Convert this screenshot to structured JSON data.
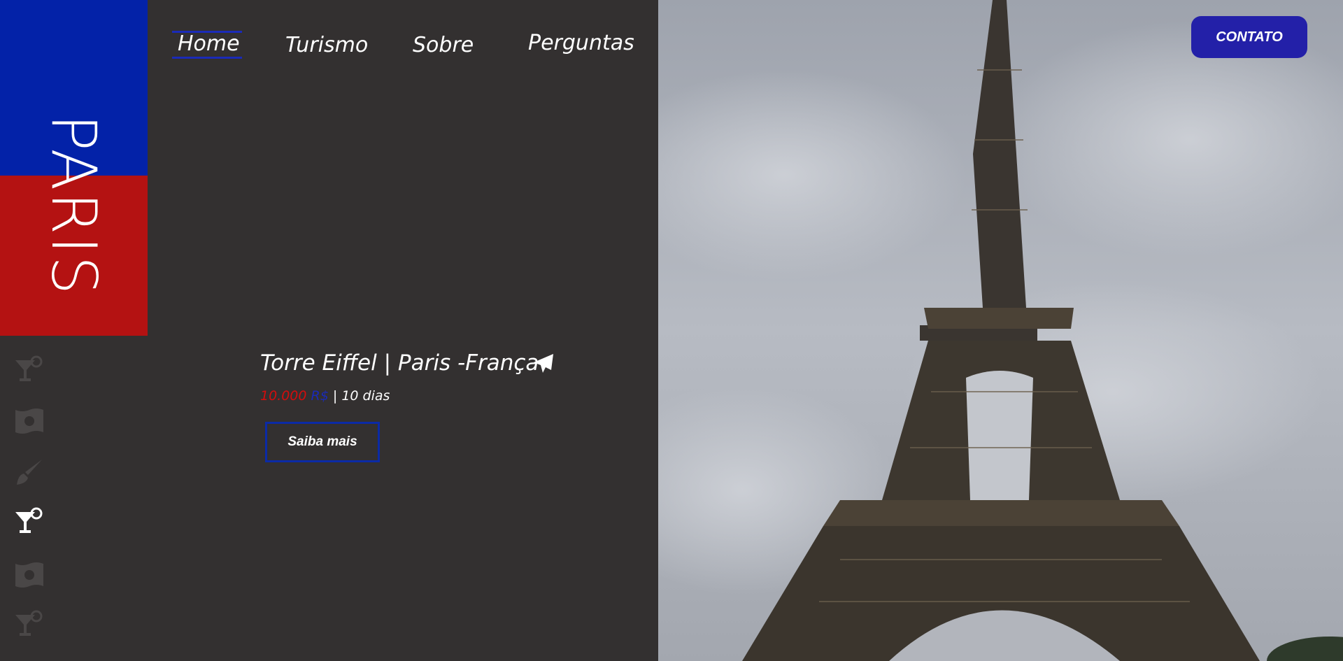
{
  "brand": {
    "title": "PARIS"
  },
  "nav": {
    "items": [
      {
        "label": "Home",
        "active": true
      },
      {
        "label": "Turismo",
        "active": false
      },
      {
        "label": "Sobre",
        "active": false
      },
      {
        "label": "Perguntas",
        "active": false
      }
    ]
  },
  "sidebar": {
    "icons": [
      {
        "name": "cocktail-icon",
        "active": false
      },
      {
        "name": "money-icon",
        "active": false
      },
      {
        "name": "brush-icon",
        "active": false
      },
      {
        "name": "cocktail-icon",
        "active": true
      },
      {
        "name": "money-icon",
        "active": false
      },
      {
        "name": "cocktail-icon",
        "active": false
      }
    ]
  },
  "hero": {
    "title": "Torre Eiffel | Paris -França",
    "price": "10.000",
    "currency": "R$",
    "separator": "|",
    "duration": "10 dias",
    "cta_label": "Saiba mais",
    "icon": "paper-plane-icon"
  },
  "header": {
    "contact_label": "CONTATO"
  },
  "colors": {
    "background": "#333030",
    "flag_blue": "#0322a8",
    "flag_red": "#b41212",
    "accent": "#2320a8",
    "price_red": "#d30d0d"
  }
}
